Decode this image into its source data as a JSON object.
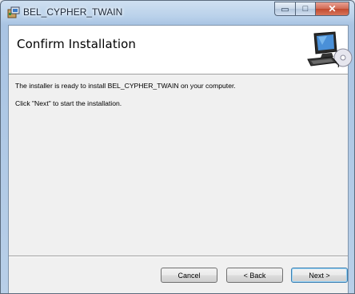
{
  "window": {
    "title": "BEL_CYPHER_TWAIN",
    "minimize_glyph": "▭",
    "maximize_glyph": "□",
    "close_glyph": "✕"
  },
  "header": {
    "title": "Confirm Installation",
    "graphic_icon": "computer-with-disc-icon"
  },
  "body": {
    "line1": "The installer is ready to install BEL_CYPHER_TWAIN on your computer.",
    "line2": "Click \"Next\" to start the installation."
  },
  "buttons": {
    "cancel": "Cancel",
    "back": "< Back",
    "next": "Next >"
  },
  "colors": {
    "window_frame": "#b9d1ea",
    "close_button": "#c24a2f",
    "dialog_face": "#f0f0f0"
  }
}
